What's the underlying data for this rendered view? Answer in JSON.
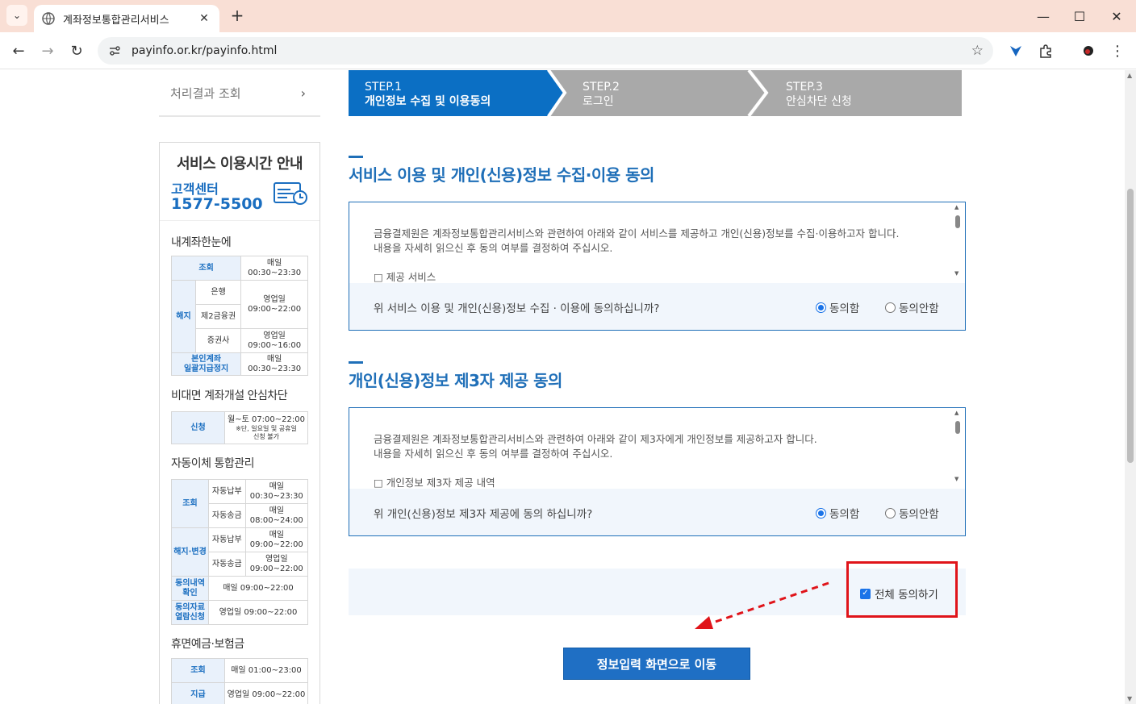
{
  "browser": {
    "tab_title": "계좌정보통합관리서비스",
    "url": "payinfo.or.kr/payinfo.html"
  },
  "sidebar": {
    "result_link": "처리결과 조회",
    "hours_title": "서비스 이용시간 안내",
    "cc_label": "고객센터",
    "cc_phone": "1577-5500",
    "sections": {
      "my_account": {
        "title": "내계좌한눈에",
        "rows": [
          {
            "a": "조회",
            "b": "",
            "time": "매일\n00:30~23:30"
          },
          {
            "a": "해지",
            "b": "은행",
            "time": ""
          },
          {
            "b": "제2금융권",
            "time": "영업일\n09:00~22:00"
          },
          {
            "b": "증권사",
            "time": "영업일\n09:00~16:00"
          },
          {
            "a": "본인계좌\n일괄지급정지",
            "time": "매일\n00:30~23:30"
          }
        ]
      },
      "nonface": {
        "title": "비대면 계좌개설 안심차단",
        "apply": "신청",
        "time": "월~토 07:00~22:00",
        "note": "※단, 일요일 및 공휴일\n신청 불가"
      },
      "autopay": {
        "title": "자동이체 통합관리",
        "inquiry": "조회",
        "cancel": "해지·변경",
        "bill": "자동납부",
        "transfer": "자동송금",
        "t1": "매일\n00:30~23:30",
        "t2": "매일\n08:00~24:00",
        "t3": "매일\n09:00~22:00",
        "t4": "영업일\n09:00~22:00",
        "confirm": "동의내역\n확인",
        "confirm_time": "매일 09:00~22:00",
        "view": "동의자료\n열람신청",
        "view_time": "영업일 09:00~22:00"
      },
      "dormant": {
        "title": "휴면예금·보험금",
        "inquiry": "조회",
        "inquiry_time": "매일 01:00~23:00",
        "pay": "지급",
        "pay_time": "영업일 09:00~22:00"
      }
    }
  },
  "steps": [
    {
      "num": "STEP.1",
      "label": "개인정보 수집 및 이용동의",
      "active": true
    },
    {
      "num": "STEP.2",
      "label": "로그인",
      "active": false
    },
    {
      "num": "STEP.3",
      "label": "안심차단 신청",
      "active": false
    }
  ],
  "consent1": {
    "heading": "서비스 이용 및 개인(신용)정보 수집·이용 동의",
    "line1": "금융결제원은 계좌정보통합관리서비스와 관련하여 아래와 같이 서비스를 제공하고 개인(신용)정보를 수집·이용하고자 합니다.",
    "line2": "내용을 자세히 읽으신 후 동의 여부를 결정하여 주십시오.",
    "line3": "□ 제공 서비스",
    "question": "위 서비스 이용 및 개인(신용)정보 수집 · 이용에 동의하십니까?",
    "agree": "동의함",
    "disagree": "동의안함"
  },
  "consent2": {
    "heading": "개인(신용)정보 제3자 제공 동의",
    "line1": "금융결제원은 계좌정보통합관리서비스와 관련하여 아래와 같이 제3자에게 개인정보를 제공하고자 합니다.",
    "line2": "내용을 자세히 읽으신 후 동의 여부를 결정하여 주십시오.",
    "line3": "□ 개인정보 제3자 제공 내역",
    "question": "위 개인(신용)정보 제3자 제공에 동의 하십니까?",
    "agree": "동의함",
    "disagree": "동의안함"
  },
  "agree_all": "전체 동의하기",
  "go_button": "정보입력 화면으로 이동",
  "colors": {
    "primary": "#1f6fb8",
    "step_active": "#0b6fc4",
    "step_inactive": "#a9a9a9",
    "highlight": "#e0141a"
  }
}
